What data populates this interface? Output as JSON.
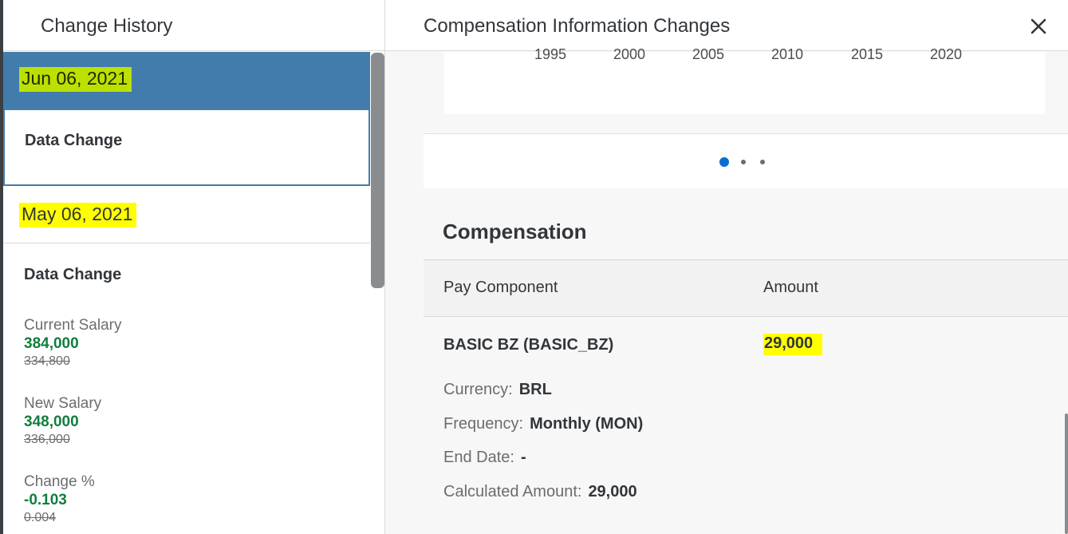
{
  "left_panel": {
    "title": "Change History",
    "entries": [
      {
        "date": "Jun 06, 2021",
        "change_label": "Data Change"
      },
      {
        "date": "May 06, 2021",
        "change_label": "Data Change",
        "fields": [
          {
            "label": "Current Salary",
            "new": "384,000",
            "old": "334,800"
          },
          {
            "label": "New Salary",
            "new": "348,000",
            "old": "336,000"
          },
          {
            "label": "Change %",
            "new": "-0.103",
            "old": "0.004"
          }
        ]
      }
    ]
  },
  "right_panel": {
    "title": "Compensation Information Changes",
    "close_icon": "close-icon",
    "chart": {
      "x_ticks": [
        "1995",
        "2000",
        "2005",
        "2010",
        "2015",
        "2020"
      ]
    },
    "carousel": {
      "pages": 3,
      "active": 1
    },
    "section_title": "Compensation",
    "table": {
      "headers": [
        "Pay Component",
        "Amount"
      ],
      "row": {
        "pay_component": "BASIC BZ (BASIC_BZ)",
        "amount": "29,000",
        "details": [
          {
            "label": "Currency:",
            "value": "BRL"
          },
          {
            "label": "Frequency:",
            "value": "Monthly (MON)"
          },
          {
            "label": "End Date:",
            "value": "-"
          },
          {
            "label": "Calculated Amount:",
            "value": "29,000"
          }
        ]
      }
    }
  },
  "colors": {
    "selected_row": "#427cac",
    "highlight": "#ffff00",
    "positive_value": "#107e3e",
    "carousel_active_dot": "#0a6ed1"
  }
}
